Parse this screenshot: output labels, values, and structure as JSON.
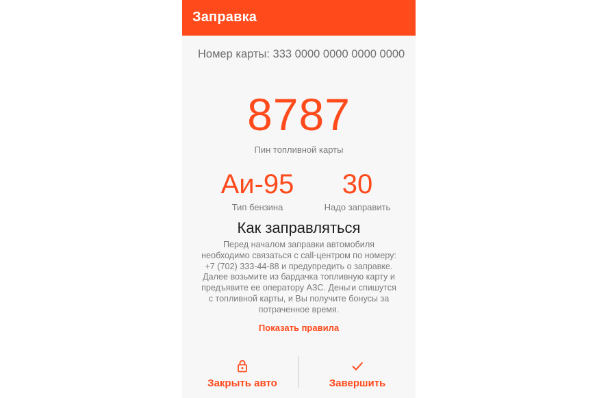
{
  "appbar": {
    "title": "Заправка",
    "color": "#ff4a1c"
  },
  "card": {
    "number_text": "Номер карты: 333 0000 0000 0000 0000"
  },
  "pin": {
    "value": "8787",
    "caption": "Пин топливной карты"
  },
  "fuel": {
    "type_value": "Аи-95",
    "type_caption": "Тип бензина",
    "amount_value": "30",
    "amount_caption": "Надо заправить"
  },
  "howto": {
    "title": "Как заправляться",
    "lines": [
      "Перед началом заправки автомобиля",
      "необходимо связаться с call-центром по номеру:",
      "+7 (702) 333-44-88 и предупредить о заправке.",
      "Далее возьмите из бардачка топливную карту и",
      "предъявите ее оператору АЗС. Деньги спишутся",
      "с топливной карты, и Вы получите бонусы за",
      "потраченное время."
    ],
    "rules_link": "Показать правила"
  },
  "actions": {
    "lock_label": "Закрыть авто",
    "lock_icon": "lock-icon",
    "finish_label": "Завершить",
    "finish_icon": "check-icon"
  },
  "colors": {
    "accent": "#ff4a1c",
    "background": "#f7f7f7",
    "text_secondary": "#7a7a7a"
  }
}
